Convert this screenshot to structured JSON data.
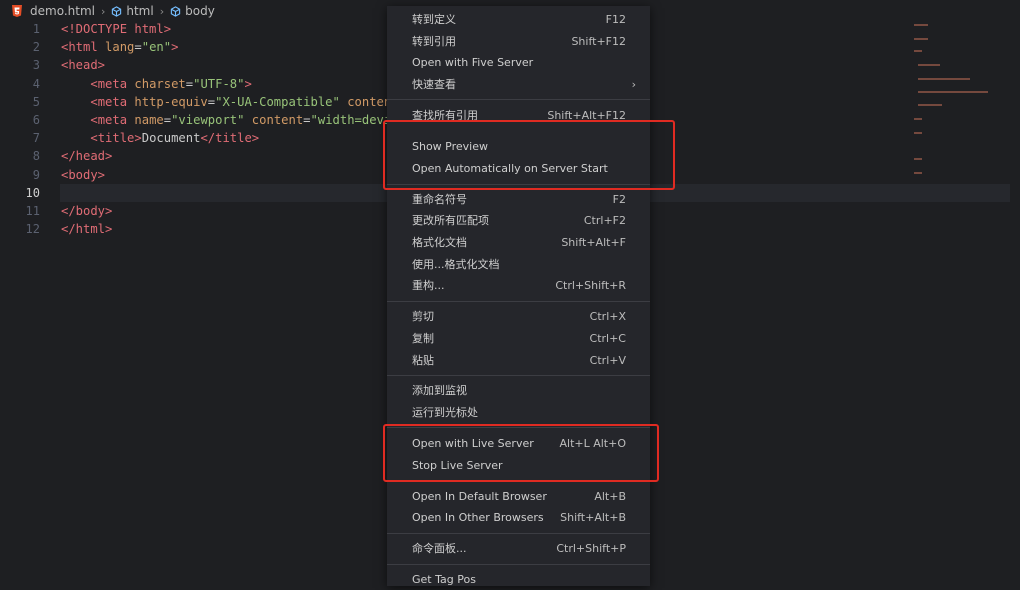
{
  "breadcrumb": {
    "file": "demo.html",
    "item1": "html",
    "item2": "body"
  },
  "gutter": [
    "1",
    "2",
    "3",
    "4",
    "5",
    "6",
    "7",
    "8",
    "9",
    "10",
    "11",
    "12"
  ],
  "code": {
    "l1": "<!DOCTYPE html>",
    "l2_open": "<html ",
    "l2_attr": "lang",
    "l2_eq": "=",
    "l2_val": "\"en\"",
    "l2_close": ">",
    "l3": "<head>",
    "l4_tag": "<meta ",
    "l4_attr": "charset",
    "l4_val": "\"UTF-8\"",
    "l4_close": ">",
    "l5_tag": "<meta ",
    "l5_attr": "http-equiv",
    "l5_val": "\"X-UA-Compatible\"",
    "l5_attr2": " conten",
    "l6_tag": "<meta ",
    "l6_attr": "name",
    "l6_val": "\"viewport\"",
    "l6_attr2": " content",
    "l6_val2": "\"width=devi",
    "l7_open": "<title>",
    "l7_text": "Document",
    "l7_close": "</title>",
    "l8": "</head>",
    "l9": "<body>",
    "l11": "</body>",
    "l12": "</html>"
  },
  "menu": {
    "items": [
      {
        "label": "转到定义",
        "key": "F12"
      },
      {
        "label": "转到引用",
        "key": "Shift+F12"
      },
      {
        "label": "Open with Five Server",
        "key": ""
      },
      {
        "label": "快速查看",
        "key": ""
      },
      {
        "label": "查找所有引用",
        "key": "Shift+Alt+F12"
      },
      {
        "label": "Show Preview",
        "key": ""
      },
      {
        "label": "Open Automatically on Server Start",
        "key": ""
      },
      {
        "label": "重命名符号",
        "key": "F2"
      },
      {
        "label": "更改所有匹配项",
        "key": "Ctrl+F2"
      },
      {
        "label": "格式化文档",
        "key": "Shift+Alt+F"
      },
      {
        "label": "使用...格式化文档",
        "key": ""
      },
      {
        "label": "重构...",
        "key": "Ctrl+Shift+R"
      },
      {
        "label": "剪切",
        "key": "Ctrl+X"
      },
      {
        "label": "复制",
        "key": "Ctrl+C"
      },
      {
        "label": "粘贴",
        "key": "Ctrl+V"
      },
      {
        "label": "添加到监视",
        "key": ""
      },
      {
        "label": "运行到光标处",
        "key": ""
      },
      {
        "label": "Open with Live Server",
        "key": "Alt+L Alt+O"
      },
      {
        "label": "Stop Live Server",
        "key": ""
      },
      {
        "label": "Open In Default Browser",
        "key": "Alt+B"
      },
      {
        "label": "Open In Other Browsers",
        "key": "Shift+Alt+B"
      },
      {
        "label": "命令面板...",
        "key": "Ctrl+Shift+P"
      },
      {
        "label": "Get Tag Pos",
        "key": ""
      }
    ]
  },
  "colors": {
    "highlight": "#e02b22",
    "menu_bg": "#25262b"
  }
}
